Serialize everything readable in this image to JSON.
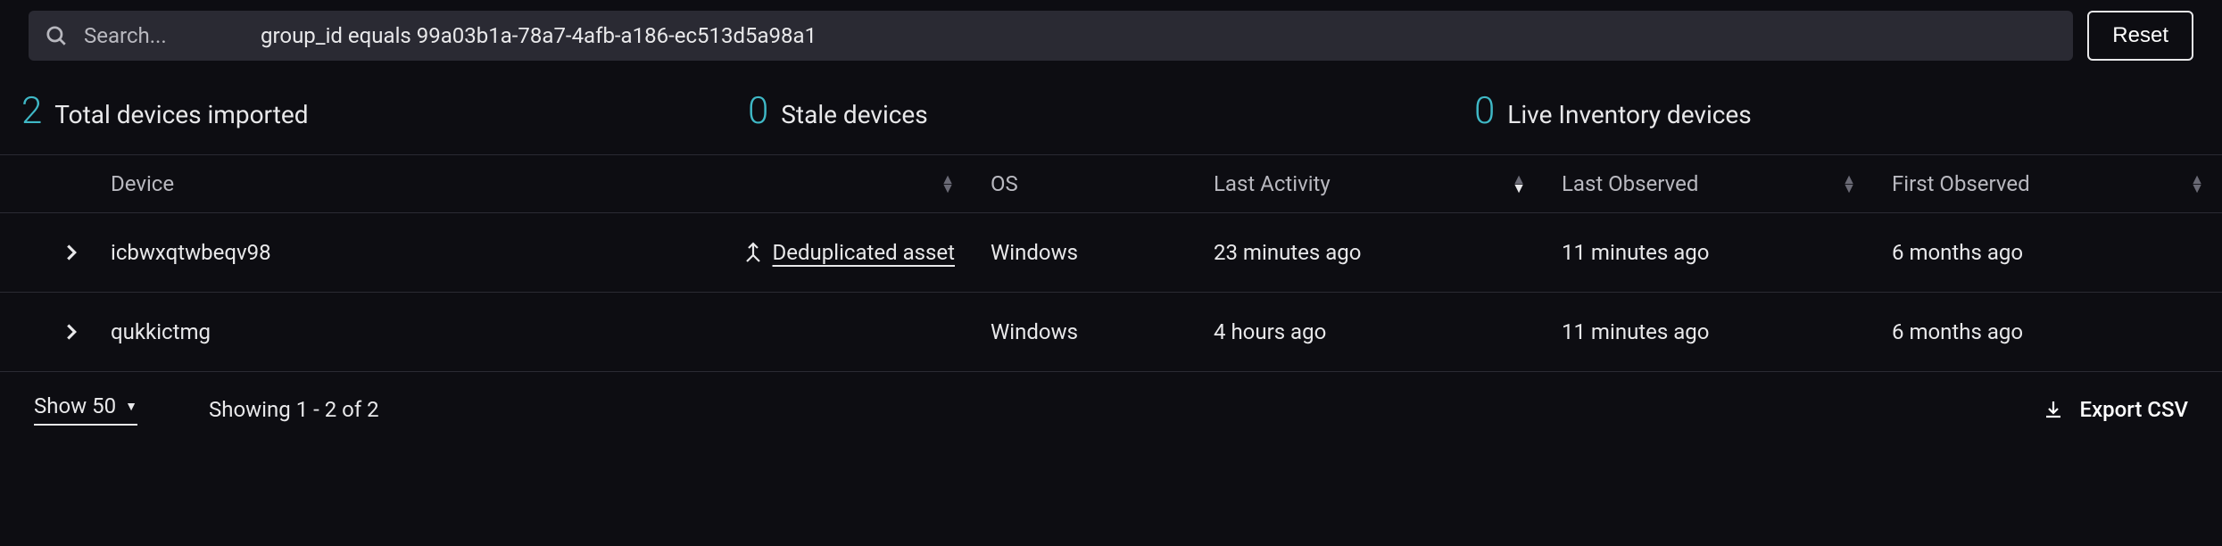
{
  "search": {
    "placeholder": "Search...",
    "query": "group_id equals 99a03b1a-78a7-4afb-a186-ec513d5a98a1",
    "reset_label": "Reset"
  },
  "stats": {
    "total": {
      "count": "2",
      "label": "Total devices imported"
    },
    "stale": {
      "count": "0",
      "label": "Stale devices"
    },
    "live": {
      "count": "0",
      "label": "Live Inventory devices"
    }
  },
  "columns": {
    "device": "Device",
    "os": "OS",
    "last_activity": "Last Activity",
    "last_observed": "Last Observed",
    "first_observed": "First Observed"
  },
  "rows": [
    {
      "device": "icbwxqtwbeqv98",
      "deduplicated": true,
      "dedup_label": "Deduplicated asset",
      "os": "Windows",
      "last_activity": "23 minutes ago",
      "last_observed": "11 minutes ago",
      "first_observed": "6 months ago"
    },
    {
      "device": "qukkictmg",
      "deduplicated": false,
      "os": "Windows",
      "last_activity": "4 hours ago",
      "last_observed": "11 minutes ago",
      "first_observed": "6 months ago"
    }
  ],
  "footer": {
    "page_size_label": "Show 50",
    "showing_text": "Showing 1 - 2 of 2",
    "export_label": "Export CSV"
  },
  "colors": {
    "accent": "#3fb8c6"
  }
}
